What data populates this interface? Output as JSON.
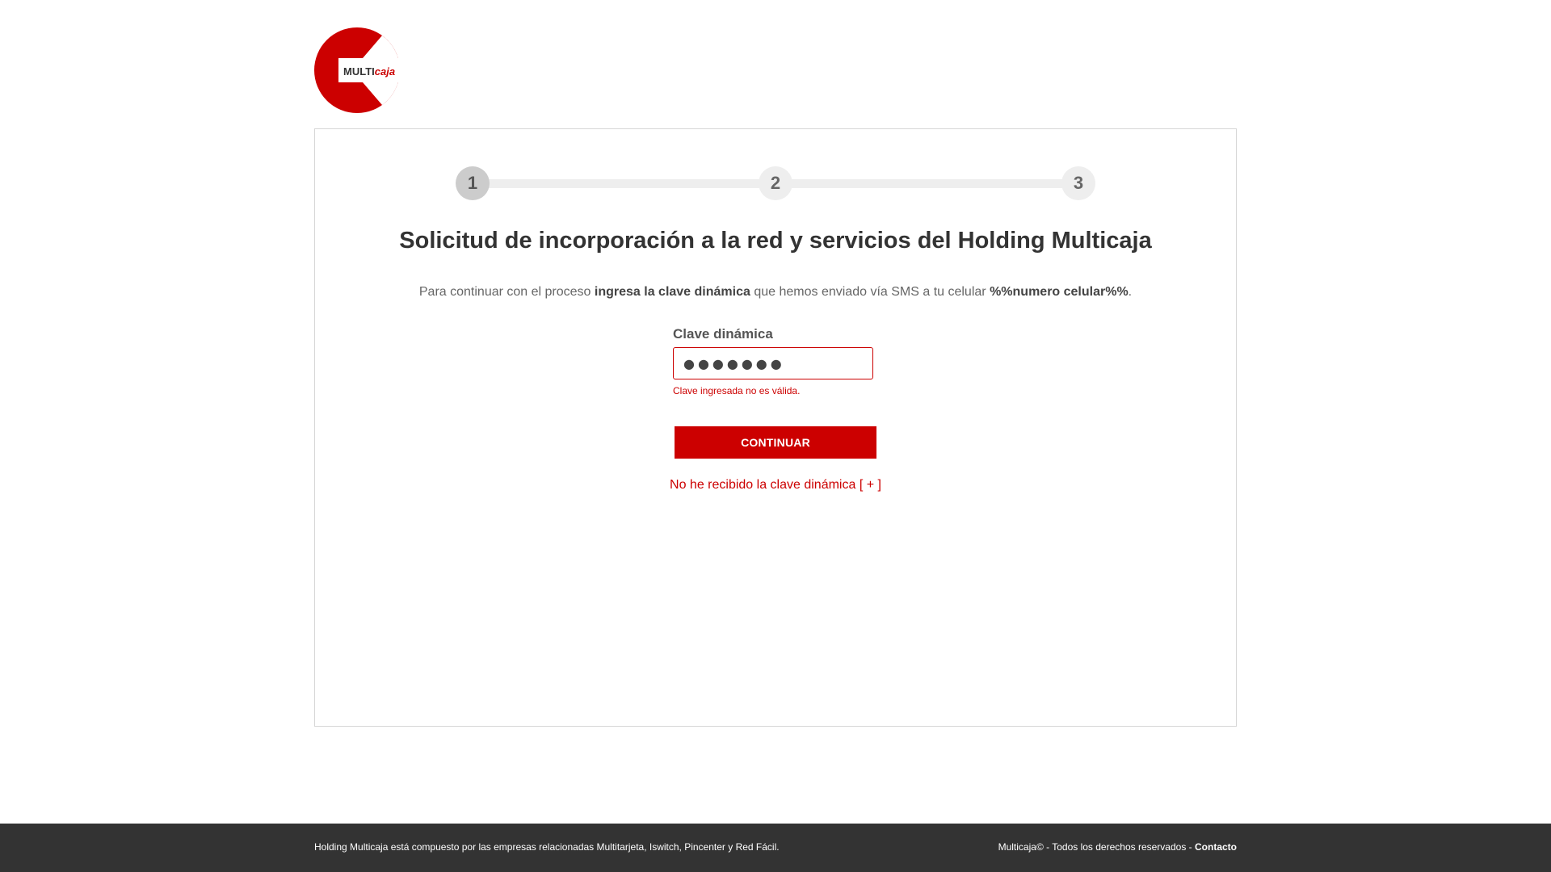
{
  "brand": {
    "logo_text_multi": "MULTI",
    "logo_text_caja": "caja",
    "primary_color": "#cc0000"
  },
  "stepper": {
    "steps": [
      "1",
      "2",
      "3"
    ],
    "active_step": 1
  },
  "page": {
    "title": "Solicitud de incorporación a la red y servicios del Holding Multicaja",
    "instruction_pre": "Para continuar con el proceso ",
    "instruction_bold1": "ingresa la clave dinámica",
    "instruction_mid": " que hemos enviado vía SMS a tu celular ",
    "instruction_bold2": "%%numero celular%%",
    "instruction_end": "."
  },
  "form": {
    "label": "Clave dinámica",
    "value_masked": "●●●●●●●",
    "error": "Clave ingresada no es válida.",
    "submit_label": "CONTINUAR",
    "resend_label": "No he recibido la clave dinámica [ + ]"
  },
  "footer": {
    "left_text": "Holding Multicaja está compuesto por las empresas relacionadas Multitarjeta, Iswitch, Pincenter y Red Fácil.",
    "right_text": "Multicaja© - Todos los derechos reservados - ",
    "contact_label": "Contacto"
  }
}
